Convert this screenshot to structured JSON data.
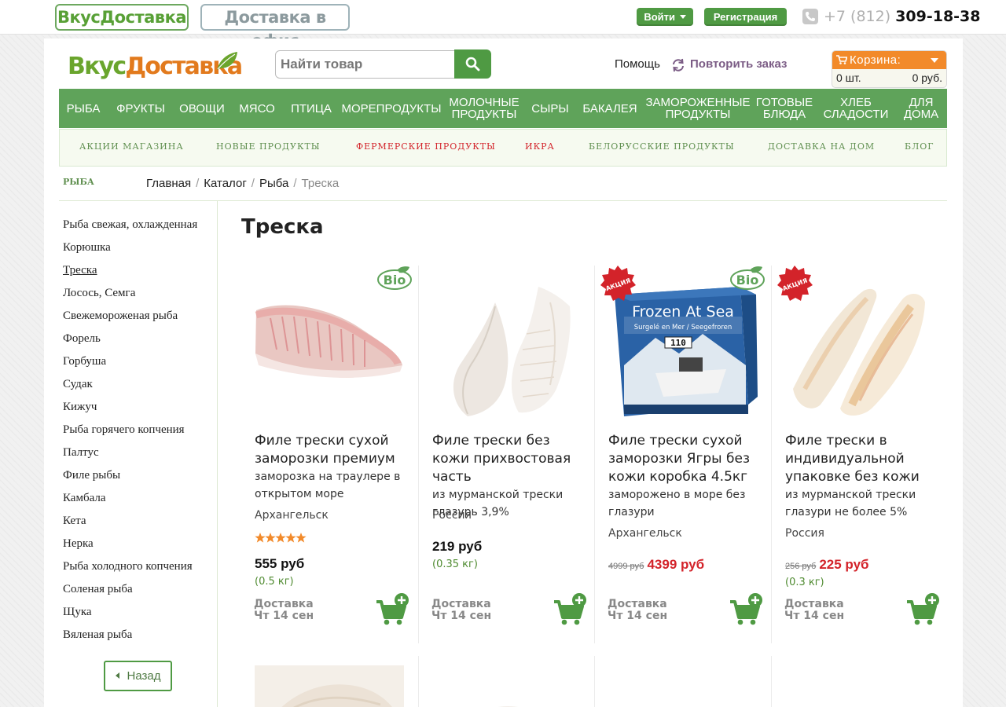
{
  "topbar": {
    "brand_button": "ВкусДоставка",
    "office_button": "Доставка в офис",
    "login": "Войти",
    "register": "Регистрация",
    "phone_code": "+7 (812)",
    "phone_number": "309-18-38"
  },
  "header": {
    "logo_part1": "Вкус",
    "logo_part2": "Доставка",
    "search_placeholder": "Найти товар",
    "help": "Помощь",
    "repeat_order": "Повторить заказ",
    "cart_title": "Корзина:",
    "cart_qty": "0 шт.",
    "cart_sum": "0 руб."
  },
  "nav": [
    {
      "label": "РЫБА"
    },
    {
      "label": "ФРУКТЫ"
    },
    {
      "label": "ОВОЩИ"
    },
    {
      "label": "МЯСО"
    },
    {
      "label": "ПТИЦА"
    },
    {
      "label": "МОРЕПРОДУКТЫ"
    },
    {
      "label": "МОЛОЧНЫЕ ПРОДУКТЫ"
    },
    {
      "label": "СЫРЫ"
    },
    {
      "label": "БАКАЛЕЯ"
    },
    {
      "label": "ЗАМОРОЖЕННЫЕ ПРОДУКТЫ"
    },
    {
      "label": "ГОТОВЫЕ БЛЮДА"
    },
    {
      "label": "ХЛЕБ СЛАДОСТИ"
    },
    {
      "label": "ДЛЯ ДОМА"
    }
  ],
  "subnav": [
    {
      "label": "АКЦИИ МАГАЗИНА"
    },
    {
      "label": "НОВЫЕ ПРОДУКТЫ"
    },
    {
      "label": "ФЕРМЕРСКИЕ ПРОДУКТЫ"
    },
    {
      "label": "ИКРА"
    },
    {
      "label": "БЕЛОРУССКИЕ ПРОДУКТЫ"
    },
    {
      "label": "ДОСТАВКА НА ДОМ"
    },
    {
      "label": "БЛОГ"
    }
  ],
  "section_label": "РЫБА",
  "breadcrumb": {
    "home": "Главная",
    "catalog": "Каталог",
    "fish": "Рыба",
    "current": "Треска",
    "separator": "/"
  },
  "sidebar": {
    "items": [
      "Рыба свежая, охлажденная",
      "Корюшка",
      "Треска",
      "Лосось, Семга",
      "Свежемороженая рыба",
      "Форель",
      "Горбуша",
      "Судак",
      "Кижуч",
      "Рыба горячего копчения",
      "Палтус",
      "Филе рыбы",
      "Камбала",
      "Кета",
      "Нерка",
      "Рыба холодного копчения",
      "Соленая рыба",
      "Щука",
      "Вяленая рыба"
    ],
    "active_index": 2,
    "back": "Назад"
  },
  "page_title": "Треска",
  "products": [
    {
      "name": "Филе трески сухой заморозки премиум",
      "desc": "заморозка на траулере в открытом море",
      "origin": "Архангельск",
      "rating": 5,
      "old_price": "",
      "price": "555 руб",
      "weight": "(0.5 кг)",
      "delivery_line1": "Доставка",
      "delivery_line2": "Чт 14 сен",
      "bio": true,
      "akcia": false,
      "akcia_label": "",
      "bio_label": "Bio"
    },
    {
      "name": "Филе трески без кожи прихвостовая часть",
      "desc": "из мурманской трески глазурь 3,9%",
      "origin": "Россия",
      "rating": 0,
      "old_price": "",
      "price": "219 руб",
      "weight": "(0.35 кг)",
      "delivery_line1": "Доставка",
      "delivery_line2": "Чт 14 сен",
      "bio": false,
      "akcia": false,
      "akcia_label": "",
      "bio_label": ""
    },
    {
      "name": "Филе трески сухой заморозки Ягры без кожи коробка 4.5кг",
      "desc": "заморожено в море без глазури",
      "origin": "Архангельск",
      "rating": 0,
      "old_price": "4999 руб",
      "price": "4399 руб",
      "weight": "",
      "delivery_line1": "Доставка",
      "delivery_line2": "Чт 14 сен",
      "bio": true,
      "akcia": true,
      "akcia_label": "АКЦИЯ",
      "bio_label": "Bio",
      "box_title": "Frozen At Sea",
      "box_sub": "Surgelé en Mer / Seegefroren",
      "box_num": "110"
    },
    {
      "name": "Филе трески в индивидуальной упаковке без кожи",
      "desc": "из мурманской трески глазури не более 5%",
      "origin": "Россия",
      "rating": 0,
      "old_price": "256 руб",
      "price": "225 руб",
      "weight": "(0.3 кг)",
      "delivery_line1": "Доставка",
      "delivery_line2": "Чт 14 сен",
      "bio": false,
      "akcia": true,
      "akcia_label": "АКЦИЯ",
      "bio_label": ""
    }
  ],
  "colors": {
    "green": "#5fa35a",
    "dark_green": "#4f9a43",
    "orange": "#f28a2a",
    "red": "#d3232a"
  }
}
